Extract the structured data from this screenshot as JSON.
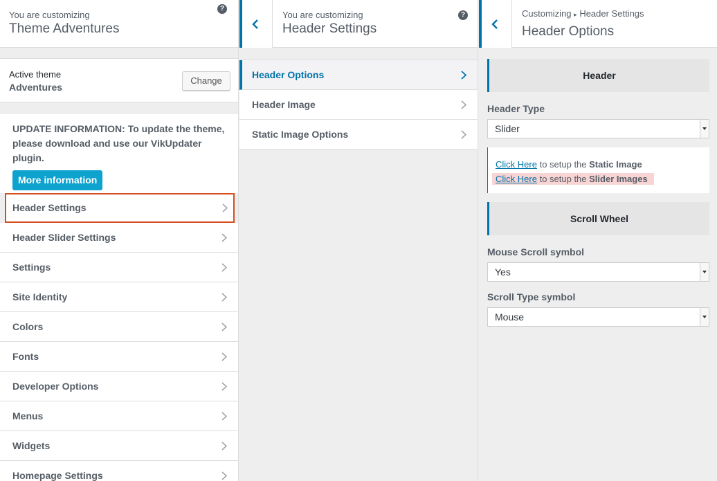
{
  "panel1": {
    "header": {
      "subtitle": "You are customizing",
      "title": "Theme Adventures",
      "help": "?"
    },
    "theme": {
      "label": "Active theme",
      "name": "Adventures",
      "change_label": "Change"
    },
    "update": {
      "text": "UPDATE INFORMATION: To update the theme, please download and use our VikUpdater plugin.",
      "button_label": "More information"
    },
    "items": [
      {
        "label": "Header Settings"
      },
      {
        "label": "Header Slider Settings"
      },
      {
        "label": "Settings"
      },
      {
        "label": "Site Identity"
      },
      {
        "label": "Colors"
      },
      {
        "label": "Fonts"
      },
      {
        "label": "Developer Options"
      },
      {
        "label": "Menus"
      },
      {
        "label": "Widgets"
      },
      {
        "label": "Homepage Settings"
      }
    ]
  },
  "panel2": {
    "header": {
      "subtitle": "You are customizing",
      "title": "Header Settings",
      "help": "?"
    },
    "items": [
      {
        "label": "Header Options"
      },
      {
        "label": "Header Image"
      },
      {
        "label": "Static Image Options"
      }
    ]
  },
  "panel3": {
    "header": {
      "breadcrumb_root": "Customizing",
      "breadcrumb_sep": "▸",
      "breadcrumb_current": "Header Settings",
      "title": "Header Options"
    },
    "section_header": "Header",
    "header_type": {
      "label": "Header Type",
      "value": "Slider"
    },
    "info": {
      "line1_link": "Click Here",
      "line1_text": " to setup the ",
      "line1_bold": "Static Image",
      "line2_link": "Click Here",
      "line2_text": " to setup the ",
      "line2_bold": "Slider Images"
    },
    "section_scroll": "Scroll Wheel",
    "mouse_scroll": {
      "label": "Mouse Scroll symbol",
      "value": "Yes"
    },
    "scroll_type": {
      "label": "Scroll Type symbol",
      "value": "Mouse"
    }
  },
  "colors": {
    "accent": "#0073aa",
    "highlight_border": "#d54e21",
    "button": "#0ea2cf"
  }
}
